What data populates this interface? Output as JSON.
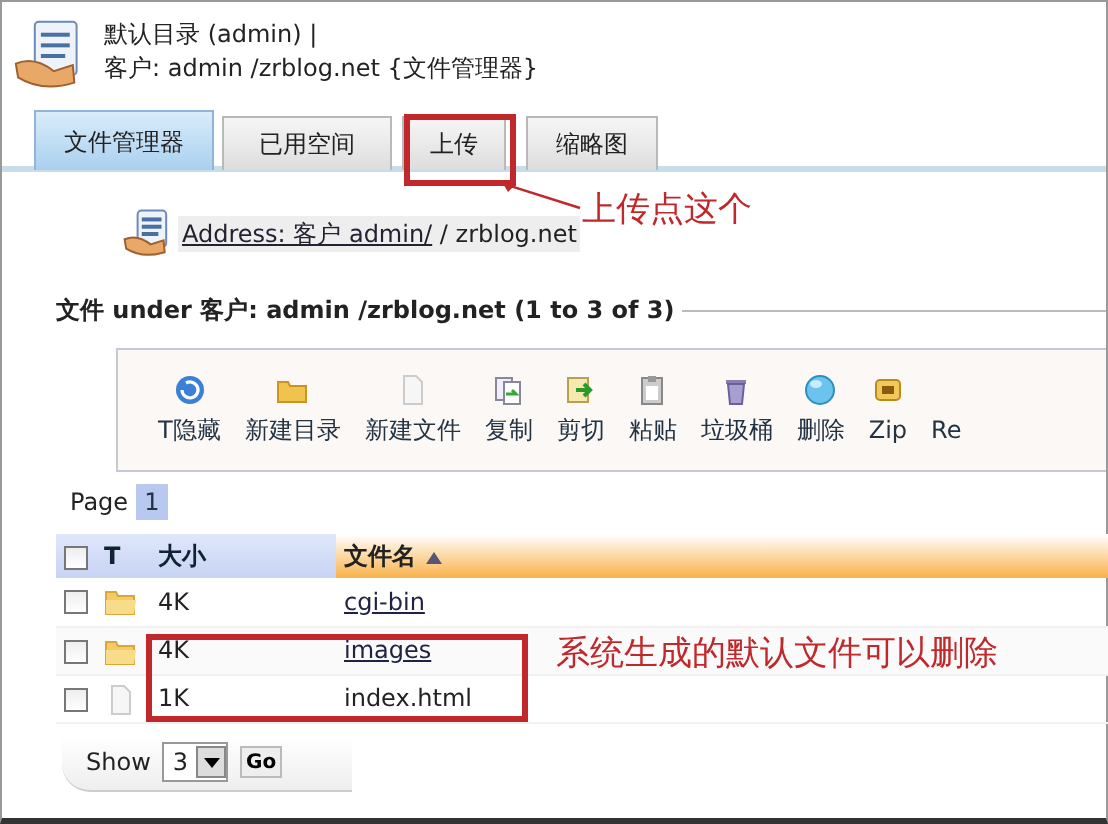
{
  "header": {
    "title": "默认目录 (admin)  |",
    "subtitle": "客户: admin /zrblog.net {文件管理器}"
  },
  "tabs": [
    {
      "label": "文件管理器",
      "selected": true
    },
    {
      "label": "已用空间",
      "selected": false
    },
    {
      "label": "上传",
      "selected": false
    },
    {
      "label": "缩略图",
      "selected": false
    }
  ],
  "address": {
    "link": "Address: 客户 admin/",
    "rest": " / zrblog.net"
  },
  "listing_title": "文件 under 客户: admin /zrblog.net (1 to 3 of 3)",
  "toolbar": [
    {
      "label": "T隐藏",
      "kind": "refresh"
    },
    {
      "label": "新建目录",
      "kind": "folder"
    },
    {
      "label": "新建文件",
      "kind": "file"
    },
    {
      "label": "复制",
      "kind": "copy"
    },
    {
      "label": "剪切",
      "kind": "move"
    },
    {
      "label": "粘贴",
      "kind": "paste"
    },
    {
      "label": "垃圾桶",
      "kind": "trash"
    },
    {
      "label": "删除",
      "kind": "ball"
    },
    {
      "label": "Zip",
      "kind": "zip"
    },
    {
      "label": "Re",
      "kind": "none"
    }
  ],
  "pager": {
    "label": "Page",
    "pages": [
      {
        "label": "1",
        "selected": true
      }
    ]
  },
  "table": {
    "columns": [
      {
        "kind": "checkbox",
        "checked": false
      },
      {
        "label": "T",
        "kind": "type"
      },
      {
        "label": "大小",
        "kind": "size"
      },
      {
        "label": "文件名",
        "kind": "name",
        "sorted": true
      }
    ],
    "rows": [
      {
        "checked": false,
        "kind": "folder",
        "size": "4K",
        "name": "cgi-bin"
      },
      {
        "checked": false,
        "kind": "folder",
        "size": "4K",
        "name": "images"
      },
      {
        "checked": false,
        "kind": "file",
        "size": "1K",
        "name": "index.html"
      }
    ]
  },
  "footer": {
    "label": "Show",
    "page_size": "3",
    "button": "Go"
  },
  "callouts": [
    {
      "text": "上传点这个"
    },
    {
      "text": "系统生成的默认文件可以删除"
    }
  ]
}
